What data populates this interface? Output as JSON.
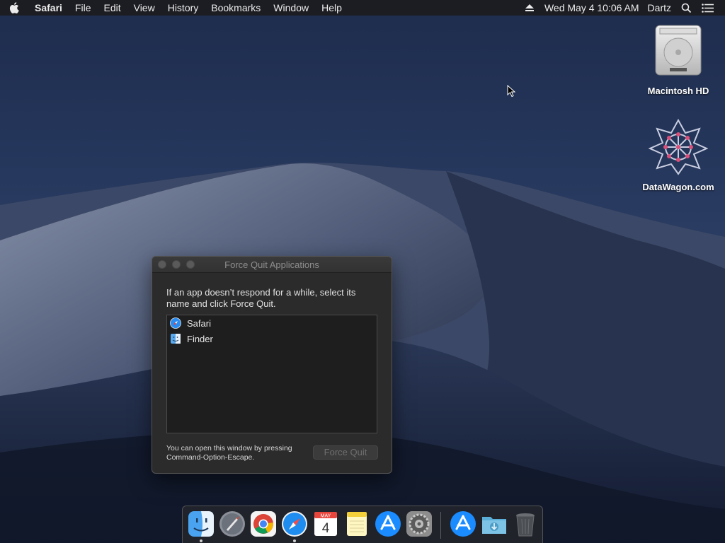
{
  "menubar": {
    "app_name": "Safari",
    "menus": [
      "File",
      "Edit",
      "View",
      "History",
      "Bookmarks",
      "Window",
      "Help"
    ],
    "date_time": "Wed May 4  10:06 AM",
    "user": "Dartz",
    "icons": [
      "apple-icon",
      "eject-icon",
      "spotlight-icon",
      "notification-center-icon"
    ]
  },
  "desktop": {
    "icons": [
      {
        "label": "Macintosh HD",
        "icon": "hard-drive-icon"
      },
      {
        "label": "DataWagon.com",
        "icon": "datawagon-icon"
      }
    ]
  },
  "force_quit": {
    "title": "Force Quit Applications",
    "description": "If an app doesn’t respond for a while, select its name and click Force Quit.",
    "apps": [
      {
        "name": "Safari",
        "icon": "safari-icon"
      },
      {
        "name": "Finder",
        "icon": "finder-icon"
      }
    ],
    "hint": "You can open this window by pressing Command-Option-Escape.",
    "button_label": "Force Quit",
    "button_enabled": false
  },
  "dock": {
    "apps": [
      {
        "name": "Finder",
        "icon": "finder-icon",
        "running": true
      },
      {
        "name": "Launchpad",
        "icon": "launchpad-icon",
        "running": false
      },
      {
        "name": "Google Chrome",
        "icon": "chrome-icon",
        "running": false
      },
      {
        "name": "Safari",
        "icon": "safari-icon",
        "running": true
      },
      {
        "name": "Calendar",
        "icon": "calendar-icon",
        "running": false,
        "month": "MAY",
        "day": "4"
      },
      {
        "name": "Notes",
        "icon": "notes-icon",
        "running": false
      },
      {
        "name": "App Store",
        "icon": "app-store-icon",
        "running": false
      },
      {
        "name": "System Preferences",
        "icon": "system-preferences-icon",
        "running": false
      },
      {
        "name": "App Store (stack)",
        "icon": "app-store-icon",
        "running": false
      },
      {
        "name": "Downloads",
        "icon": "downloads-folder-icon",
        "running": false
      },
      {
        "name": "Trash",
        "icon": "trash-icon",
        "running": false
      }
    ]
  },
  "colors": {
    "accent": "#1a8cff",
    "menubar": "#1c1c1e",
    "window_bg": "#2b2b2b"
  }
}
